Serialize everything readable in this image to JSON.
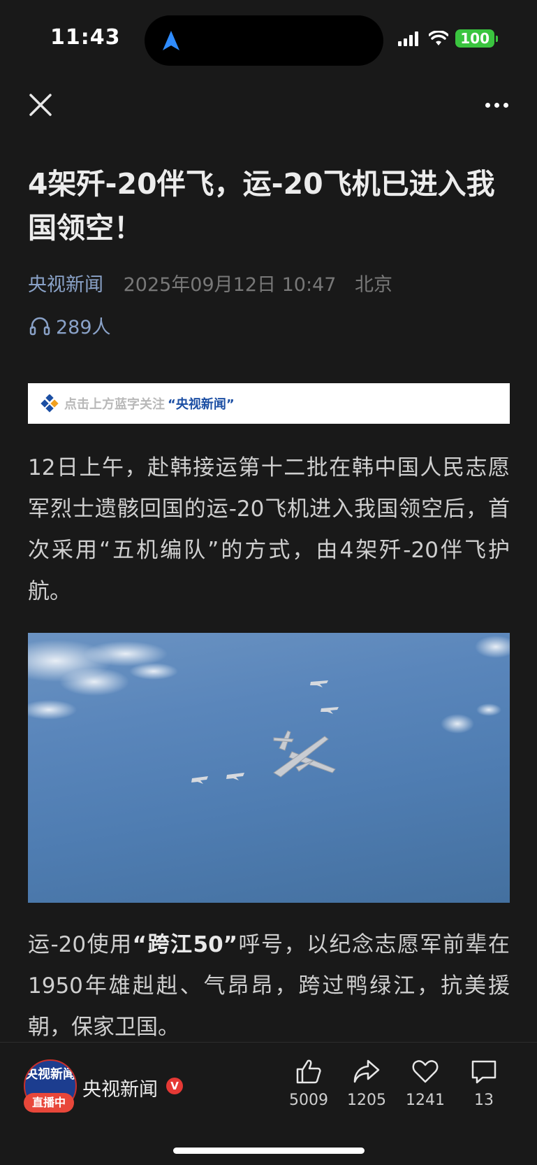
{
  "status": {
    "time": "11:43",
    "battery": "100"
  },
  "article": {
    "title": "4架歼-20伴飞，运-20飞机已进入我国领空！",
    "source": "央视新闻",
    "datetime": "2025年09月12日 10:47",
    "location": "北京",
    "listeners": "289人",
    "follow_text": "点击上方蓝字关注",
    "follow_brand": "“央视新闻”",
    "para1": "12日上午，赴韩接运第十二批在韩中国人民志愿军烈士遗骸回国的运-20飞机进入我国领空后，首次采用“五机编队”的方式，由4架歼-20伴飞护航。",
    "para2_before": "运-20使用",
    "para2_bold": "“跨江50”",
    "para2_after": "呼号，以纪念志愿军前辈在1950年雄赳赳、气昂昂，跨过鸭绿江，抗美援朝，保家卫国。"
  },
  "bottom": {
    "avatar_text": "央视新闻",
    "live_label": "直播中",
    "channel_name": "央视新闻",
    "verified_label": "V",
    "like_count": "5009",
    "share_count": "1205",
    "fav_count": "1241",
    "comment_count": "13"
  },
  "icons": [
    "navigation-arrow-icon",
    "signal-icon",
    "wifi-icon",
    "close-icon",
    "more-icon",
    "headphones-icon",
    "like-icon",
    "share-icon",
    "favorite-icon",
    "comment-icon"
  ],
  "colors": {
    "background": "#191919",
    "link": "#8aa2c8",
    "live_badge": "#e8473a",
    "battery": "#3ac43f"
  }
}
